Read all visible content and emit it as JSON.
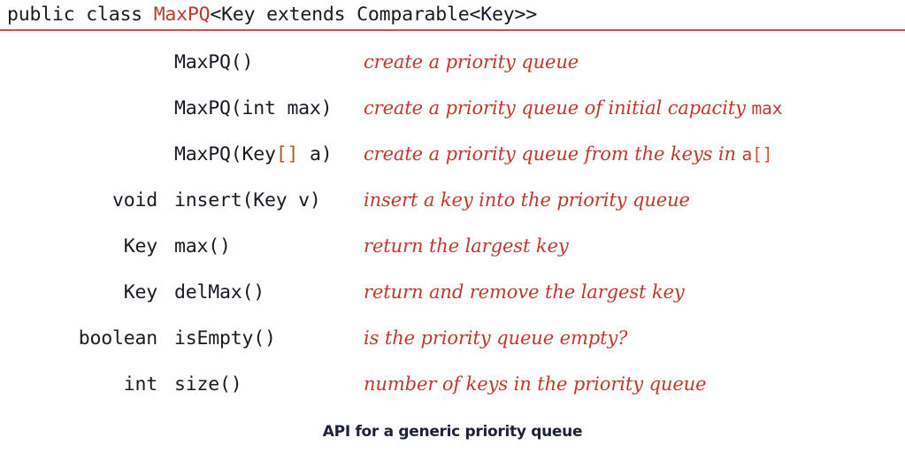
{
  "figure": {
    "caption": "API for a generic priority queue",
    "accent_color": "#c0392b",
    "rule_color": "#cf5149",
    "text_color": "#1a1a24",
    "caption_color": "#1d2236",
    "background_color": "#ffffff"
  },
  "class_declaration": {
    "prefix": "public class ",
    "class_name": "MaxPQ",
    "generics": "<Key extends Comparable<Key>>"
  },
  "api_rows": [
    {
      "return_type": "",
      "signature_pre": "MaxPQ()",
      "signature_brackets": "",
      "signature_post": "",
      "description_pre": "create a priority queue",
      "description_code": "",
      "description_code_brackets": "",
      "description_post": ""
    },
    {
      "return_type": "",
      "signature_pre": "MaxPQ(int max)",
      "signature_brackets": "",
      "signature_post": "",
      "description_pre": "create a priority queue of initial capacity ",
      "description_code": "max",
      "description_code_brackets": "",
      "description_post": ""
    },
    {
      "return_type": "",
      "signature_pre": "MaxPQ(Key",
      "signature_brackets": "[]",
      "signature_post": " a)",
      "description_pre": "create a priority queue from the keys in ",
      "description_code": "a",
      "description_code_brackets": "[]",
      "description_post": ""
    },
    {
      "return_type": "void",
      "signature_pre": "insert(Key v)",
      "signature_brackets": "",
      "signature_post": "",
      "description_pre": "insert a key into the priority queue",
      "description_code": "",
      "description_code_brackets": "",
      "description_post": ""
    },
    {
      "return_type": "Key",
      "signature_pre": "max()",
      "signature_brackets": "",
      "signature_post": "",
      "description_pre": "return the largest key",
      "description_code": "",
      "description_code_brackets": "",
      "description_post": ""
    },
    {
      "return_type": "Key",
      "signature_pre": "delMax()",
      "signature_brackets": "",
      "signature_post": "",
      "description_pre": "return and remove the largest key",
      "description_code": "",
      "description_code_brackets": "",
      "description_post": ""
    },
    {
      "return_type": "boolean",
      "signature_pre": "isEmpty()",
      "signature_brackets": "",
      "signature_post": "",
      "description_pre": "is the priority queue empty?",
      "description_code": "",
      "description_code_brackets": "",
      "description_post": ""
    },
    {
      "return_type": "int",
      "signature_pre": "size()",
      "signature_brackets": "",
      "signature_post": "",
      "description_pre": "number of keys in the priority queue",
      "description_code": "",
      "description_code_brackets": "",
      "description_post": ""
    }
  ]
}
